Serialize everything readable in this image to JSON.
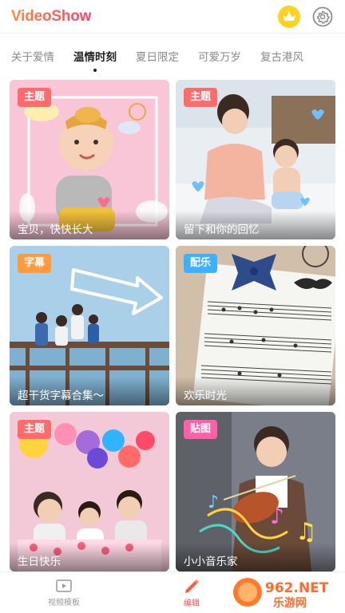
{
  "header": {
    "logo": "VideoShow",
    "vip_icon": "crown-icon",
    "settings_icon": "gear-icon"
  },
  "tabs": [
    {
      "label": "关于爱情",
      "active": false
    },
    {
      "label": "温情时刻",
      "active": true
    },
    {
      "label": "夏日限定",
      "active": false
    },
    {
      "label": "可爱万岁",
      "active": false
    },
    {
      "label": "复古港风",
      "active": false
    }
  ],
  "cards": [
    {
      "badge": "主题",
      "badge_color": "#ff6b6b",
      "title": "宝贝，快快长大"
    },
    {
      "badge": "主题",
      "badge_color": "#ff6b6b",
      "title": "留下和你的回忆"
    },
    {
      "badge": "字幕",
      "badge_color": "#ff9a3d",
      "title": "超干货字幕合集～"
    },
    {
      "badge": "配乐",
      "badge_color": "#3db0ff",
      "title": "欢乐时光"
    },
    {
      "badge": "主题",
      "badge_color": "#ff6b6b",
      "title": "生日快乐"
    },
    {
      "badge": "贴图",
      "badge_color": "#ff5fa8",
      "title": "小小音乐家"
    }
  ],
  "bottom_nav": {
    "items": [
      {
        "label": "视频模板",
        "icon": "video-template-icon",
        "active": false
      },
      {
        "label": "编辑",
        "icon": "edit-pencil-icon",
        "active": true
      }
    ]
  },
  "watermark": {
    "brand": "962.NET",
    "site": "乐游网"
  }
}
